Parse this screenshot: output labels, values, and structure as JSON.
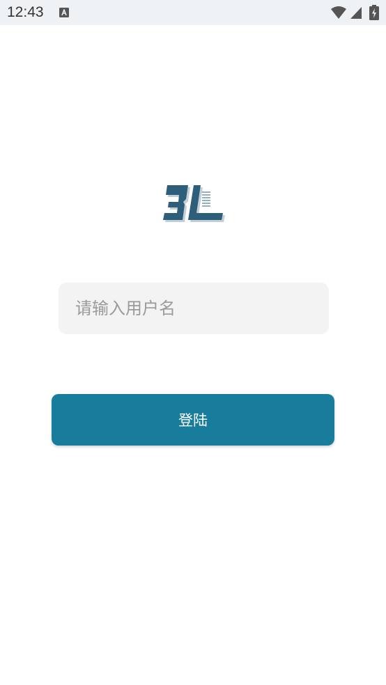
{
  "status_bar": {
    "time": "12:43",
    "icons": [
      "notification-a-icon",
      "wifi-icon",
      "cell-signal-icon",
      "battery-charging-icon"
    ]
  },
  "logo": {
    "icon": "3l-logo",
    "color": "#2e5f7a"
  },
  "login_form": {
    "username_placeholder": "请输入用户名",
    "username_value": "",
    "login_label": "登陆"
  },
  "colors": {
    "primary": "#187c9c",
    "input_background": "#f3f3f3",
    "status_bar_background": "#eef2f5"
  }
}
